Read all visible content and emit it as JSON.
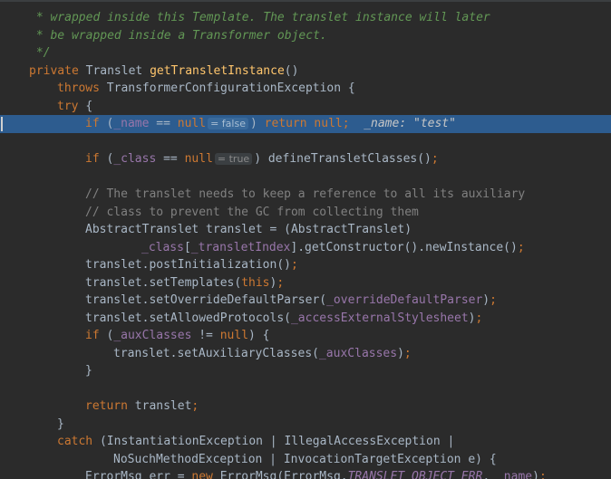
{
  "editor": {
    "lines": [
      {
        "indent": 1,
        "tokens": [
          {
            "t": " * wrapped inside this Template. The translet instance will later",
            "c": "dc"
          }
        ]
      },
      {
        "indent": 1,
        "tokens": [
          {
            "t": " * be wrapped inside a Transformer object.",
            "c": "dc"
          }
        ]
      },
      {
        "indent": 1,
        "tokens": [
          {
            "t": " */",
            "c": "dc"
          }
        ]
      },
      {
        "indent": 1,
        "tokens": [
          {
            "t": "private ",
            "c": "kw"
          },
          {
            "t": "Translet "
          },
          {
            "t": "getTransletInstance",
            "c": "fn"
          },
          {
            "t": "()"
          }
        ]
      },
      {
        "indent": 2,
        "tokens": [
          {
            "t": "throws ",
            "c": "kw"
          },
          {
            "t": "TransformerConfigurationException {"
          }
        ]
      },
      {
        "indent": 2,
        "tokens": [
          {
            "t": "try ",
            "c": "kw"
          },
          {
            "t": "{"
          }
        ]
      },
      {
        "indent": 3,
        "highlight": true,
        "tokens": [
          {
            "t": "if ",
            "c": "kw"
          },
          {
            "t": "("
          },
          {
            "t": "_name",
            "c": "fld"
          },
          {
            "t": " == "
          },
          {
            "t": "null",
            "c": "kw"
          },
          {
            "hint": "= false"
          },
          {
            "t": ") "
          },
          {
            "t": "return null",
            "c": "kw"
          },
          {
            "t": ";",
            "c": "kw"
          },
          {
            "t": "  _name: ",
            "c": "inline-val"
          },
          {
            "t": "\"test\"",
            "c": "inline-str"
          }
        ]
      },
      {
        "indent": 0,
        "tokens": []
      },
      {
        "indent": 3,
        "tokens": [
          {
            "t": "if ",
            "c": "kw"
          },
          {
            "t": "("
          },
          {
            "t": "_class",
            "c": "fld"
          },
          {
            "t": " == "
          },
          {
            "t": "null",
            "c": "kw"
          },
          {
            "hint": "= true"
          },
          {
            "t": ") defineTransletClasses()"
          },
          {
            "t": ";",
            "c": "kw"
          }
        ]
      },
      {
        "indent": 0,
        "tokens": []
      },
      {
        "indent": 3,
        "tokens": [
          {
            "t": "// The translet needs to keep a reference to all its auxiliary",
            "c": "cm"
          }
        ]
      },
      {
        "indent": 3,
        "tokens": [
          {
            "t": "// class to prevent the GC from collecting them",
            "c": "cm"
          }
        ]
      },
      {
        "indent": 3,
        "tokens": [
          {
            "t": "AbstractTranslet translet = (AbstractTranslet)"
          }
        ]
      },
      {
        "indent": 5,
        "tokens": [
          {
            "t": "_class",
            "c": "fld"
          },
          {
            "t": "["
          },
          {
            "t": "_transletIndex",
            "c": "fld"
          },
          {
            "t": "].getConstructor().newInstance()"
          },
          {
            "t": ";",
            "c": "kw"
          }
        ]
      },
      {
        "indent": 3,
        "tokens": [
          {
            "t": "translet.postInitialization()"
          },
          {
            "t": ";",
            "c": "kw"
          }
        ]
      },
      {
        "indent": 3,
        "tokens": [
          {
            "t": "translet.setTemplates("
          },
          {
            "t": "this",
            "c": "kw"
          },
          {
            "t": ")"
          },
          {
            "t": ";",
            "c": "kw"
          }
        ]
      },
      {
        "indent": 3,
        "tokens": [
          {
            "t": "translet.setOverrideDefaultParser("
          },
          {
            "t": "_overrideDefaultParser",
            "c": "fld"
          },
          {
            "t": ")"
          },
          {
            "t": ";",
            "c": "kw"
          }
        ]
      },
      {
        "indent": 3,
        "tokens": [
          {
            "t": "translet.setAllowedProtocols("
          },
          {
            "t": "_accessExternalStylesheet",
            "c": "fld"
          },
          {
            "t": ")"
          },
          {
            "t": ";",
            "c": "kw"
          }
        ]
      },
      {
        "indent": 3,
        "tokens": [
          {
            "t": "if ",
            "c": "kw"
          },
          {
            "t": "("
          },
          {
            "t": "_auxClasses",
            "c": "fld"
          },
          {
            "t": " != "
          },
          {
            "t": "null",
            "c": "kw"
          },
          {
            "t": ") {"
          }
        ]
      },
      {
        "indent": 4,
        "tokens": [
          {
            "t": "translet.setAuxiliaryClasses("
          },
          {
            "t": "_auxClasses",
            "c": "fld"
          },
          {
            "t": ")"
          },
          {
            "t": ";",
            "c": "kw"
          }
        ]
      },
      {
        "indent": 3,
        "tokens": [
          {
            "t": "}"
          }
        ]
      },
      {
        "indent": 0,
        "tokens": []
      },
      {
        "indent": 3,
        "tokens": [
          {
            "t": "return ",
            "c": "kw"
          },
          {
            "t": "translet"
          },
          {
            "t": ";",
            "c": "kw"
          }
        ]
      },
      {
        "indent": 2,
        "tokens": [
          {
            "t": "}"
          }
        ]
      },
      {
        "indent": 2,
        "tokens": [
          {
            "t": "catch ",
            "c": "kw"
          },
          {
            "t": "(InstantiationException | IllegalAccessException |"
          }
        ]
      },
      {
        "indent": 4,
        "tokens": [
          {
            "t": "NoSuchMethodException | InvocationTargetException e) {"
          }
        ]
      },
      {
        "indent": 3,
        "tokens": [
          {
            "t": "ErrorMsg err = "
          },
          {
            "t": "new ",
            "c": "kw"
          },
          {
            "t": "ErrorMsg(ErrorMsg."
          },
          {
            "t": "TRANSLET_OBJECT_ERR",
            "c": "fi"
          },
          {
            "t": ", "
          },
          {
            "t": "_name",
            "c": "fld"
          },
          {
            "t": ")"
          },
          {
            "t": ";",
            "c": "kw"
          }
        ]
      }
    ]
  }
}
